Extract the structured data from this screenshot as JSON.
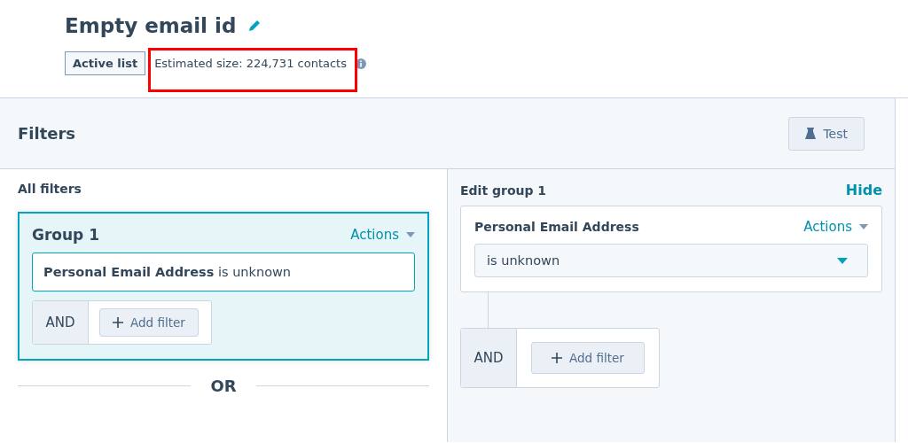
{
  "header": {
    "title": "Empty email id",
    "badge": "Active list",
    "estimated_size": "Estimated size: 224,731 contacts",
    "highlighted": true
  },
  "filters_bar": {
    "title": "Filters",
    "test_button": "Test"
  },
  "all_filters": {
    "title": "All filters",
    "groups": [
      {
        "title": "Group 1",
        "actions": "Actions",
        "selected": true,
        "filters": [
          "**Personal Email Address** is unknown"
        ],
        "and_label": "AND",
        "add_filter": "Add filter"
      }
    ],
    "or_label": "OR"
  },
  "edit_group": {
    "title": "Edit group 1",
    "hide": "Hide",
    "property": "Personal Email Address",
    "actions": "Actions",
    "operator": "is unknown",
    "and_label": "AND",
    "add_filter": "Add filter"
  }
}
